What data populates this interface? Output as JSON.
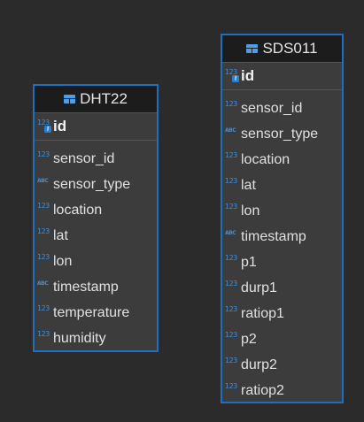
{
  "icons": {
    "numeric_type": "123",
    "string_type": "ABC",
    "key": "⚷"
  },
  "entities": {
    "dht22": {
      "title": "DHT22",
      "pk": {
        "name": "id",
        "type": "123"
      },
      "columns": [
        {
          "name": "sensor_id",
          "type": "123"
        },
        {
          "name": "sensor_type",
          "type": "ABC"
        },
        {
          "name": "location",
          "type": "123"
        },
        {
          "name": "lat",
          "type": "123"
        },
        {
          "name": "lon",
          "type": "123"
        },
        {
          "name": "timestamp",
          "type": "ABC"
        },
        {
          "name": "temperature",
          "type": "123"
        },
        {
          "name": "humidity",
          "type": "123"
        }
      ]
    },
    "sds011": {
      "title": "SDS011",
      "pk": {
        "name": "id",
        "type": "123"
      },
      "columns": [
        {
          "name": "sensor_id",
          "type": "123"
        },
        {
          "name": "sensor_type",
          "type": "ABC"
        },
        {
          "name": "location",
          "type": "123"
        },
        {
          "name": "lat",
          "type": "123"
        },
        {
          "name": "lon",
          "type": "123"
        },
        {
          "name": "timestamp",
          "type": "ABC"
        },
        {
          "name": "p1",
          "type": "123"
        },
        {
          "name": "durp1",
          "type": "123"
        },
        {
          "name": "ratiop1",
          "type": "123"
        },
        {
          "name": "p2",
          "type": "123"
        },
        {
          "name": "durp2",
          "type": "123"
        },
        {
          "name": "ratiop2",
          "type": "123"
        }
      ]
    }
  },
  "colors": {
    "background": "#2b2b2b",
    "entity_border": "#1e6fbf",
    "type_icon": "#3d8fd8"
  }
}
